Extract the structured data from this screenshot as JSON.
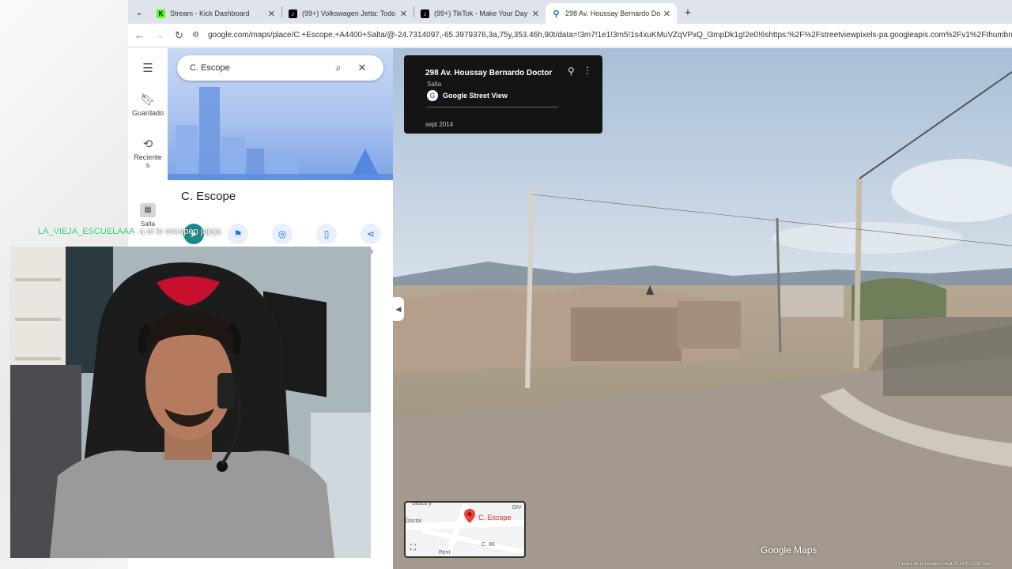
{
  "browser": {
    "tabs": [
      {
        "label": "Stream - Kick Dashboard",
        "favicon": "kick-icon",
        "color": "#53fc18"
      },
      {
        "label": "(99+) Volkswagen Jetta: Todo s",
        "favicon": "tiktok-icon",
        "color": "#000000"
      },
      {
        "label": "(99+) TikTok - Make Your Day",
        "favicon": "tiktok-icon",
        "color": "#000000"
      },
      {
        "label": "298 Av. Houssay Bernardo Doc",
        "favicon": "maps-pin-icon",
        "color": "#1a73e8"
      }
    ],
    "url": "google.com/maps/place/C.+Escope,+A4400+Salta/@-24.7314097,-65.3979376,3a,75y,353.46h,90t/data=!3m7!1e1!3m5!1s4xuKMuVZqVPxQ_l3mpDk1g!2e0!6shttps:%2F%2Fstreetviewpixels-pa.googleapis.com%2Fv1%2Fthumbnail%3Fcb"
  },
  "rail": {
    "saved": "Guardado",
    "recent": "Reciente\ns",
    "salta": "Salta"
  },
  "search": {
    "value": "C. Escope"
  },
  "place": {
    "title": "C. Escope",
    "share_label_fragment": "tir"
  },
  "chat": {
    "user": "LA_VIEJA_ESCUELAAA",
    "message": "a el lo escopen jajaja"
  },
  "streetview": {
    "address": "298 Av. Houssay Bernardo Doctor",
    "city": "Salta",
    "source": "Google Street View",
    "date": "sept 2014",
    "watermark": "Google Maps",
    "credit": "Fecha de la imagen: sept 2014   © 2026 Goo"
  },
  "minimap": {
    "label": "C. Escope",
    "streets": [
      "Sesus y",
      "Doctor",
      "DIV",
      "C. 96",
      "Perit"
    ]
  },
  "colors": {
    "maps_blue": "#1a73e8",
    "pin_red": "#d93025"
  }
}
